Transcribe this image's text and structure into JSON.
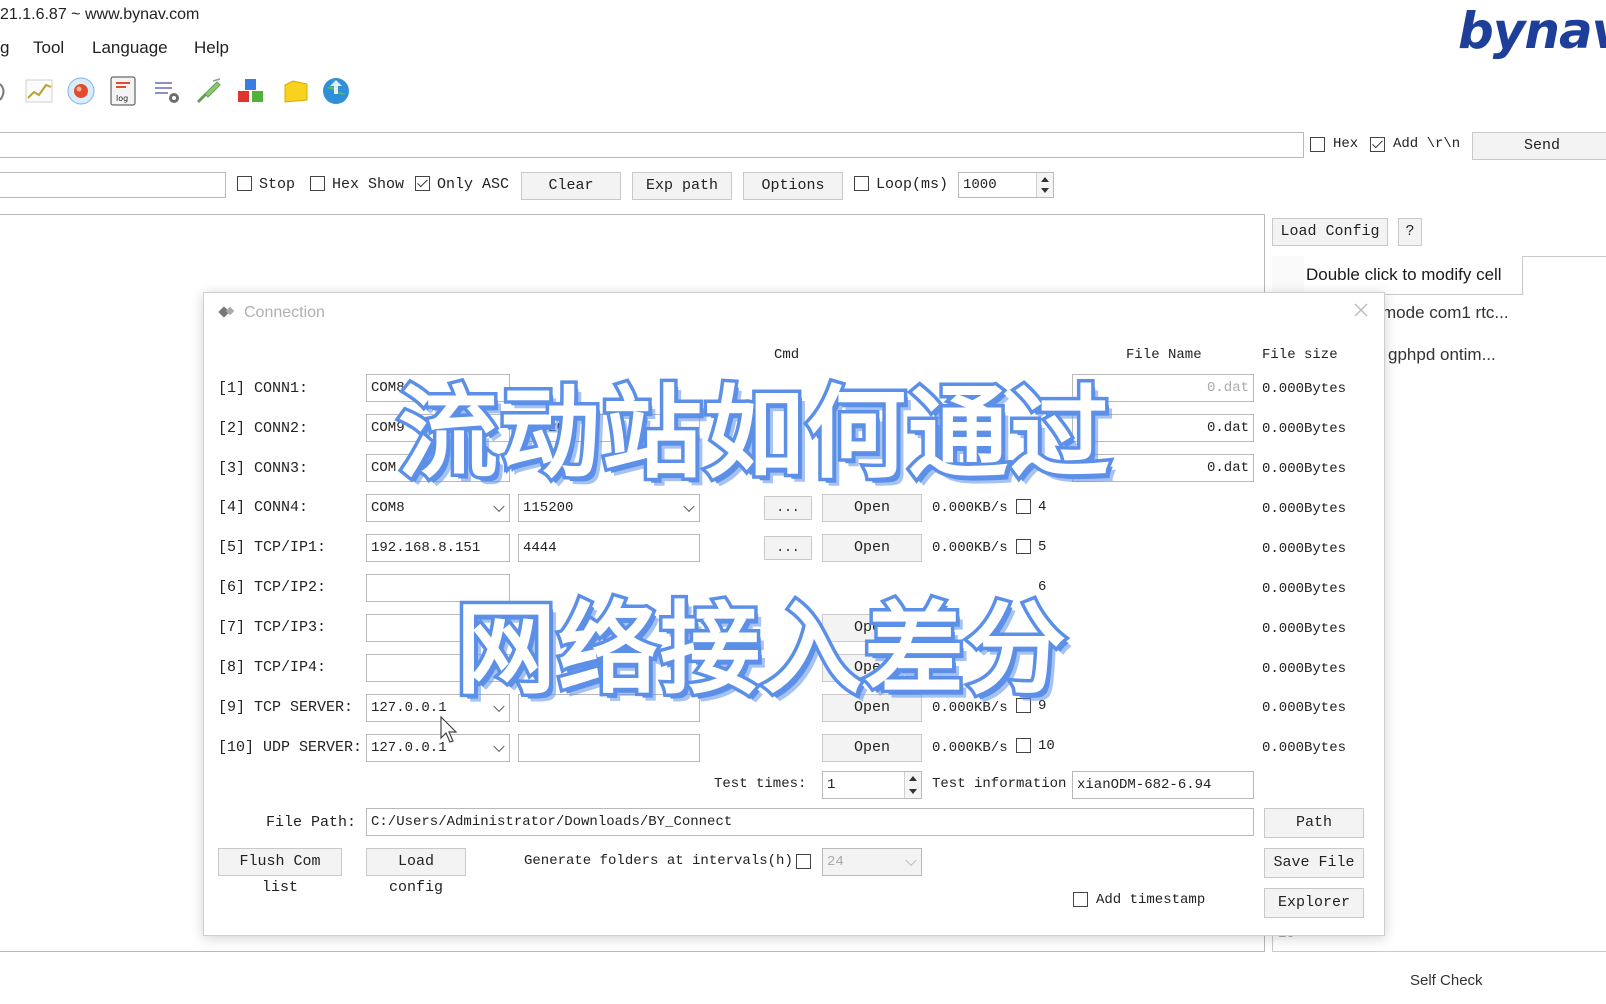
{
  "window": {
    "title": "21.1.6.87 ~ www.bynav.com",
    "logo_text": "bynav"
  },
  "menu": [
    "g",
    "Tool",
    "Language",
    "Help"
  ],
  "toolbar_icons": [
    "chart-line-icon",
    "record-icon",
    "log-icon",
    "settings-list-icon",
    "satellite-icon",
    "cubes-icon",
    "folder-icon",
    "globe-update-icon"
  ],
  "send_bar": {
    "command_value": "",
    "hex_label": "Hex",
    "hex_checked": false,
    "add_rn_label": "Add \\r\\n",
    "add_rn_checked": true,
    "send_label": "Send"
  },
  "view_bar": {
    "port_select": "",
    "stop_label": "Stop",
    "stop_checked": false,
    "hexshow_label": "Hex Show",
    "hexshow_checked": false,
    "onlyasc_label": "Only ASC",
    "onlyasc_checked": true,
    "clear_label": "Clear",
    "exp_path_label": "Exp path",
    "options_label": "Options",
    "loop_label": "Loop(ms)",
    "loop_checked": false,
    "loop_value": "1000"
  },
  "right_panel": {
    "load_config_label": "Load Config",
    "help_label": "?",
    "header_cell": "Double click to modify cell",
    "rows": [
      "mode com1 rtc...",
      "gphpd ontim..."
    ],
    "footer_fragment": "10"
  },
  "dialog": {
    "title": "Connection",
    "headers": {
      "cmd": "Cmd",
      "file_name": "File Name",
      "file_size": "File size"
    },
    "rows": [
      {
        "label": "[1] CONN1:",
        "port": "COM8",
        "baud": "",
        "speed": "",
        "idx": "",
        "file": "0.dat",
        "size": "0.000Bytes"
      },
      {
        "label": "[2] CONN2:",
        "port": "COM9",
        "baud": "115200",
        "speed": "",
        "idx": "",
        "file": "0.dat",
        "size": "0.000Bytes"
      },
      {
        "label": "[3] CONN3:",
        "port": "COM",
        "baud": "",
        "speed": "",
        "idx": "",
        "file": "0.dat",
        "size": "0.000Bytes"
      },
      {
        "label": "[4] CONN4:",
        "port": "COM8",
        "baud": "115200",
        "speed": "0.000KB/s",
        "idx": "4",
        "file": "",
        "size": "0.000Bytes"
      },
      {
        "label": "[5] TCP/IP1:",
        "port": "192.168.8.151",
        "baud": "4444",
        "speed": "0.000KB/s",
        "idx": "5",
        "file": "",
        "size": "0.000Bytes"
      },
      {
        "label": "[6] TCP/IP2:",
        "port": "",
        "baud": "",
        "speed": "",
        "idx": "6",
        "file": "",
        "size": "0.000Bytes"
      },
      {
        "label": "[7] TCP/IP3:",
        "port": "",
        "baud": "",
        "speed": "",
        "idx": "",
        "file": "",
        "size": "0.000Bytes"
      },
      {
        "label": "[8] TCP/IP4:",
        "port": "",
        "baud": "",
        "speed": "",
        "idx": "8",
        "file": "",
        "size": "0.000Bytes"
      },
      {
        "label": "[9] TCP SERVER:",
        "port": "127.0.0.1",
        "baud": "",
        "speed": "0.000KB/s",
        "idx": "9",
        "file": "",
        "size": "0.000Bytes"
      },
      {
        "label": "[10] UDP SERVER:",
        "port": "127.0.0.1",
        "baud": "",
        "speed": "0.000KB/s",
        "idx": "10",
        "file": "",
        "size": "0.000Bytes"
      }
    ],
    "dots_label": "...",
    "open_label": "Open",
    "test_times_label": "Test times:",
    "test_times_value": "1",
    "test_info_label": "Test information",
    "test_info_value": "xianODM-682-6.94",
    "file_path_label": "File Path:",
    "file_path_value": "C:/Users/Administrator/Downloads/BY_Connect",
    "path_btn": "Path",
    "flush_btn": "Flush Com list",
    "load_config_btn": "Load config",
    "generate_label": "Generate folders at intervals(h)",
    "generate_checked": false,
    "interval_value": "24",
    "save_file_btn": "Save File",
    "add_timestamp_label": "Add timestamp",
    "add_timestamp_checked": false,
    "explorer_btn": "Explorer"
  },
  "overlay": {
    "line1": "流动站如何通过",
    "line2": "网络接入差分"
  },
  "status": {
    "self_check": "Self Check"
  }
}
